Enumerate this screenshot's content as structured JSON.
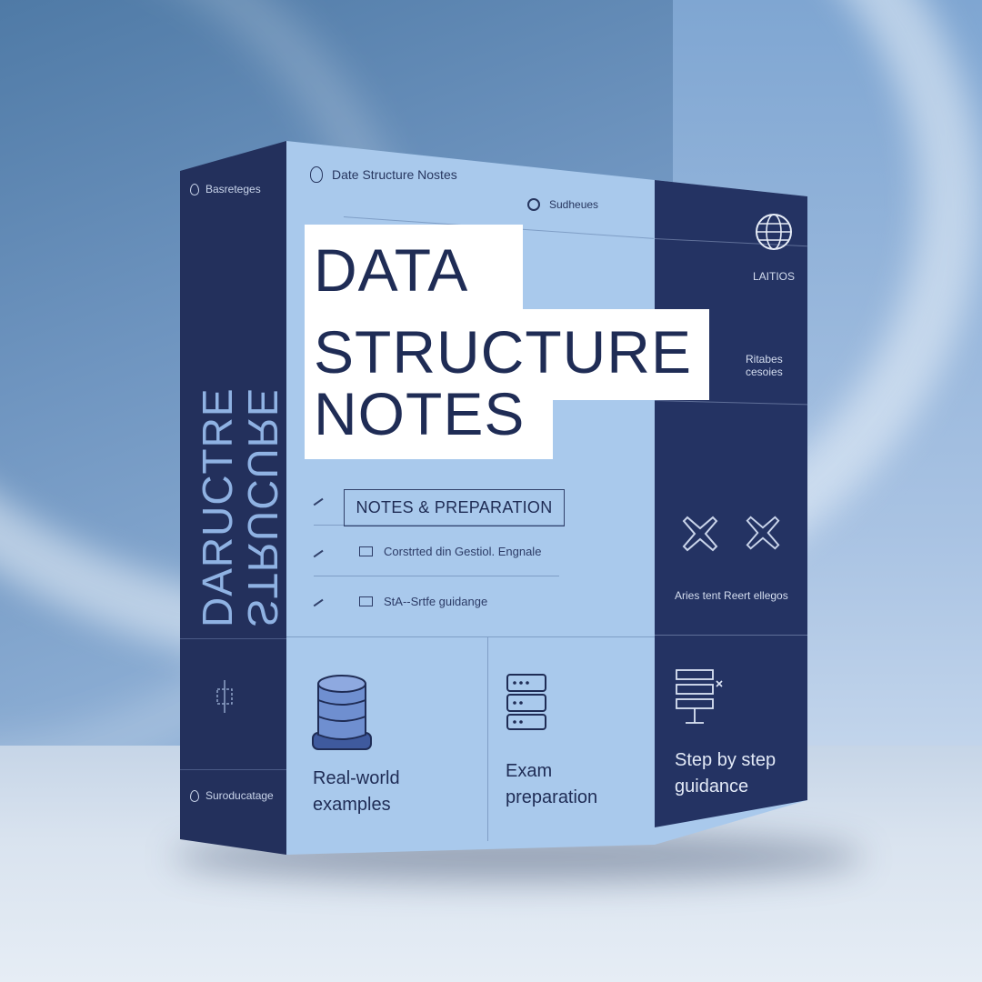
{
  "spine": {
    "top_label": "Basreteges",
    "vertical_line1": "DARUCTRE",
    "vertical_line2": "STRUCURE",
    "bottom_label": "Suroducatage"
  },
  "front": {
    "top_label_left": "Date Structure Nostes",
    "top_label_right": "Sudheues",
    "title_lines": [
      "DATA",
      "STRUCTURE",
      "NOTES"
    ],
    "subtitle": "NOTES & PREPARATION",
    "features": [
      "Corstrted din Gestiol. Engnale",
      "StA--Srtfe guidange"
    ],
    "bottom_panels": [
      {
        "line1": "Real-world",
        "line2": "examples",
        "icon": "database-stack-icon"
      },
      {
        "line1": "Exam",
        "line2": "preparation",
        "icon": "server-rack-icon"
      },
      {
        "line1": "Step by step",
        "line2": "guidance",
        "icon": "flowchart-icon"
      }
    ]
  },
  "side_panel": {
    "label1": "LAITIOS",
    "label2_line1": "Ritabes",
    "label2_line2": "cesoies",
    "label3": "Aries tent Reert ellegos"
  },
  "colors": {
    "navy": "#243363",
    "light_blue": "#a9c9ec",
    "title_text": "#1f2c55",
    "white": "#ffffff"
  }
}
